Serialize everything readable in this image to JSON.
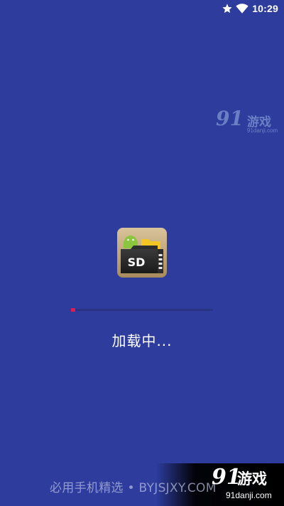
{
  "status_bar": {
    "time": "10:29",
    "icons": [
      "star-icon",
      "wifi-icon"
    ]
  },
  "watermark_top": {
    "logo_number": "91",
    "name": "游戏",
    "url": "91danji.com"
  },
  "app": {
    "icon": "sd-card-folder-icon",
    "icon_text": "SD"
  },
  "loading": {
    "progress_percent": 3,
    "text": "加载中..."
  },
  "bottom_watermark": {
    "text": "必用手机精选 • BYJSJXY.COM",
    "logo_number": "91",
    "name": "游戏",
    "url": "91danji.com"
  },
  "colors": {
    "background": "#2d3c9d",
    "progress_track": "#2a3582",
    "progress_fill": "#e01b55",
    "text": "#ffffff"
  }
}
